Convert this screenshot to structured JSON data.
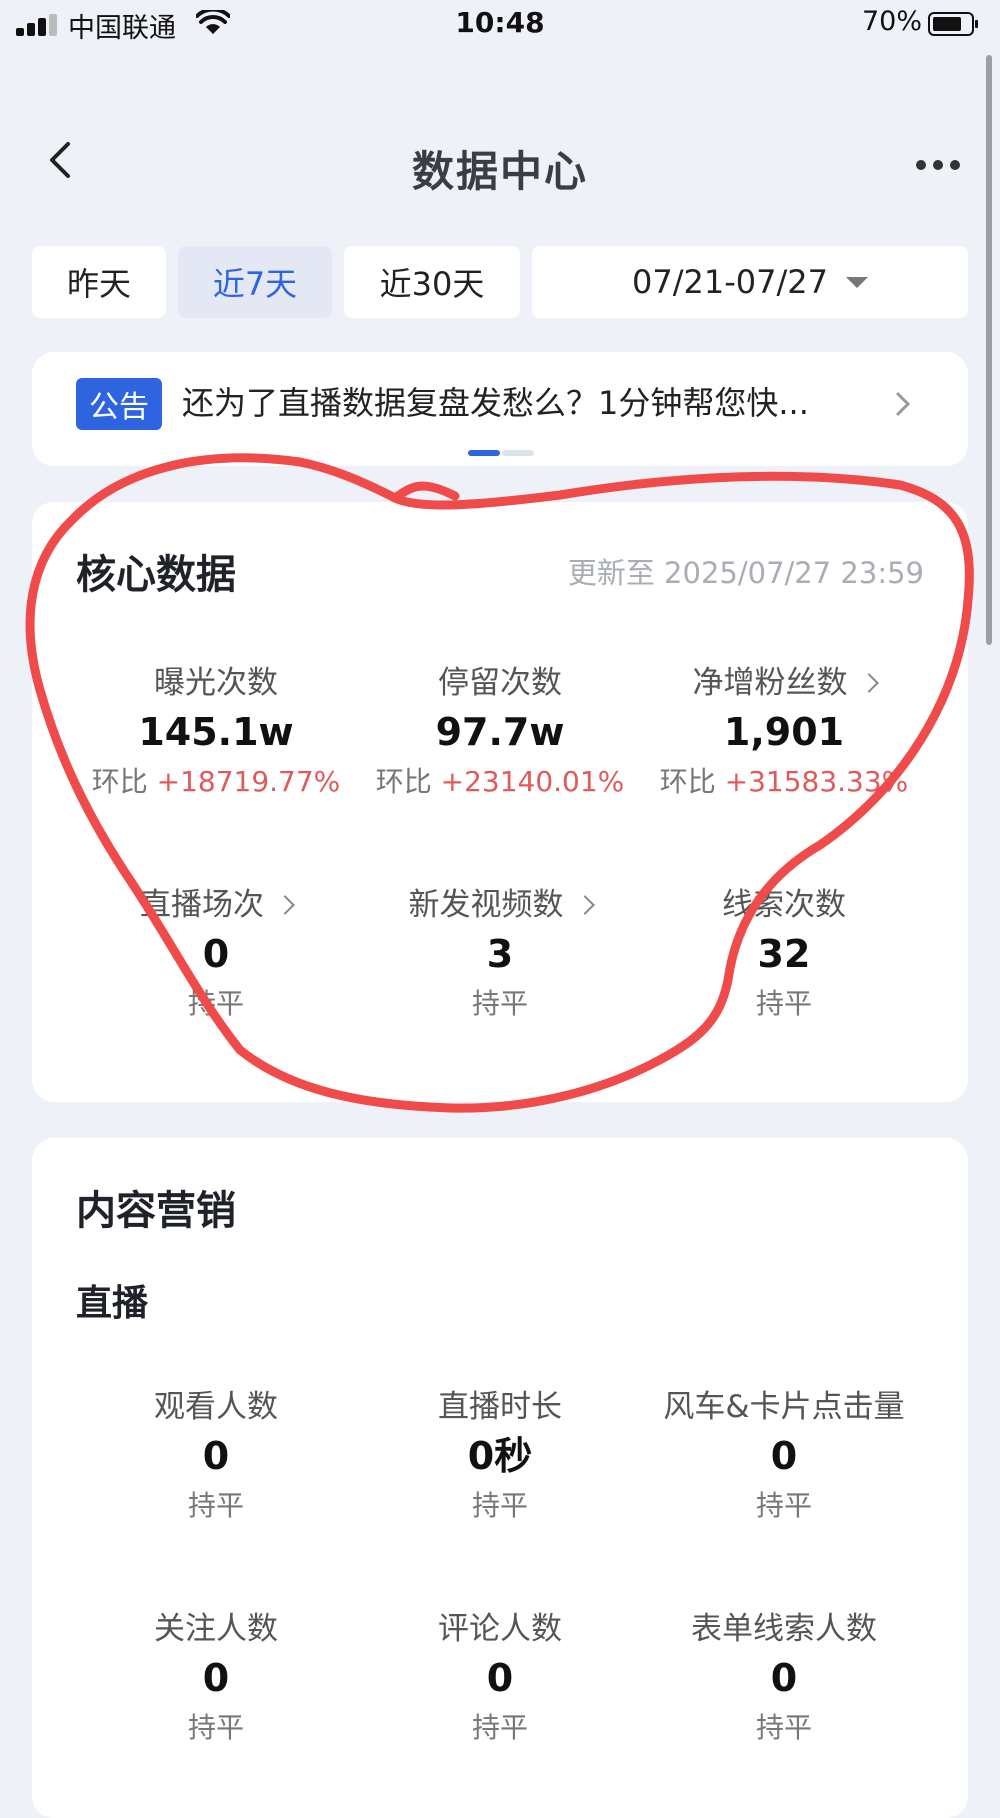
{
  "status_bar": {
    "carrier": "中国联通",
    "time": "10:48",
    "battery": "70%"
  },
  "header": {
    "title": "数据中心"
  },
  "tabs": [
    {
      "label": "昨天",
      "active": false
    },
    {
      "label": "近7天",
      "active": true
    },
    {
      "label": "近30天",
      "active": false
    }
  ],
  "date_range": "07/21-07/27",
  "notice": {
    "badge": "公告",
    "text": "还为了直播数据复盘发愁么？1分钟帮您快..."
  },
  "core": {
    "title": "核心数据",
    "updated": "更新至 2025/07/27 23:59",
    "metrics": [
      {
        "label": "曝光次数",
        "value": "145.1w",
        "change_prefix": "环比 ",
        "change": "+18719.77%"
      },
      {
        "label": "停留次数",
        "value": "97.7w",
        "change_prefix": "环比 ",
        "change": "+23140.01%"
      },
      {
        "label": "净增粉丝数",
        "value": "1,901",
        "change_prefix": "环比 ",
        "change": "+31583.33%"
      },
      {
        "label": "直播场次",
        "value": "0",
        "change": "持平"
      },
      {
        "label": "新发视频数",
        "value": "3",
        "change": "持平"
      },
      {
        "label": "线索次数",
        "value": "32",
        "change": "持平"
      }
    ]
  },
  "content": {
    "title": "内容营销",
    "section": "直播",
    "metrics": [
      {
        "label": "观看人数",
        "value": "0",
        "change": "持平"
      },
      {
        "label": "直播时长",
        "value": "0秒",
        "change": "持平"
      },
      {
        "label": "风车&卡片点击量",
        "value": "0",
        "change": "持平"
      },
      {
        "label": "关注人数",
        "value": "0",
        "change": "持平"
      },
      {
        "label": "评论人数",
        "value": "0",
        "change": "持平"
      },
      {
        "label": "表单线索人数",
        "value": "0",
        "change": "持平"
      }
    ]
  },
  "colors": {
    "accent": "#2f64e0",
    "increase": "#e05a5a",
    "annotation": "#ef4b4b"
  }
}
